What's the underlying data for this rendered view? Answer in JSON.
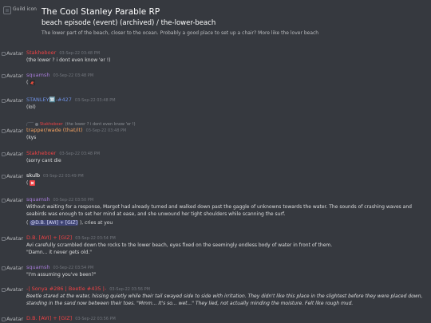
{
  "header": {
    "guild_icon_alt": "Guild icon",
    "server_name": "The Cool Stanley Parable RP",
    "channel_path": "beach episode (event) (archived) / the-lower-beach",
    "topic": "The lower part of the beach, closer to the ocean. Probably a good place to set up a chair? More like the lover beach"
  },
  "avatar_alt": "Avatar",
  "colors": {
    "red_author": "#ed4245",
    "purple_author": "#a57bd6",
    "blue_author": "#6d8fe0",
    "orange_author": "#f4a261",
    "white_author": "#ffffff",
    "mention_bg": "#5865f2"
  },
  "messages": [
    {
      "author": "Stakheboer",
      "author_color": "#ed4245",
      "timestamp": "03-Sep-22 03:48 PM",
      "content": "(the lower ? i dont even know 'er !)"
    },
    {
      "author": "squamsh",
      "author_color": "#a57bd6",
      "timestamp": "03-Sep-22 03:48 PM",
      "content": "(",
      "emoji": "bird-emoji"
    },
    {
      "author": "STANLEY🔟-#427",
      "author_color": "#6d8fe0",
      "timestamp": "03-Sep-22 03:48 PM",
      "content": "(lol)"
    },
    {
      "reply_author": "Stakheboer",
      "reply_text": "(the lower ? i dont even know 'er !)",
      "author": "trapper/wade (that/it)",
      "author_color": "#f4a261",
      "timestamp": "03-Sep-22 03:48 PM",
      "content": "(kys"
    },
    {
      "author": "Stakheboer",
      "author_color": "#ed4245",
      "timestamp": "03-Sep-22 03:48 PM",
      "content": "(sorry cant die"
    },
    {
      "author": "skulb",
      "author_color": "#ffffff",
      "timestamp": "03-Sep-22 03:49 PM",
      "content": "(",
      "emoji": "x-emoji"
    },
    {
      "author": "squamsh",
      "author_color": "#a57bd6",
      "timestamp": "03-Sep-22 03:50 PM",
      "content": "Without waiting for a response, Margot had already turned and walked down past the gaggle of unknowns towards the water. The sounds of crashing waves and seabirds was enough to set her mind at ease, and she unwound her tight shoulders while scanning the surf.",
      "mention_prefix": "( ",
      "mention": "@D.B. [AVI] + [GIZ]",
      "mention_suffix": " ), cries at you"
    },
    {
      "author": "D.B. [AVI] + [GIZ]",
      "author_color": "#ed4245",
      "timestamp": "03-Sep-22 03:54 PM",
      "content": "Avi carefully scrambled down the rocks to the lower beach, eyes fixed on the seemingly endless body of water in front of them.",
      "content2": "\"Damn... it never gets old.\""
    },
    {
      "author": "squamsh",
      "author_color": "#a57bd6",
      "timestamp": "03-Sep-22 03:54 PM",
      "content": "\"I'm assuming you've been?\""
    },
    {
      "author": "-| Sonya #286 | Beetle #435 |-",
      "author_color": "#ed4245",
      "timestamp": "03-Sep-22 03:56 PM",
      "content": "Beetle stared at the water, hissing quietly while their tail swayed side to side with irritation. They didn't like this place in the slightest before they were placed down, standing in the sand now between their toes. \"Mmm... It's so... wet...\" They lied, not actually minding the moisture. Felt like rough mud."
    },
    {
      "author": "D.B. [AVI] + [GIZ]",
      "author_color": "#ed4245",
      "timestamp": "03-Sep-22 03:56 PM",
      "content": ""
    }
  ]
}
